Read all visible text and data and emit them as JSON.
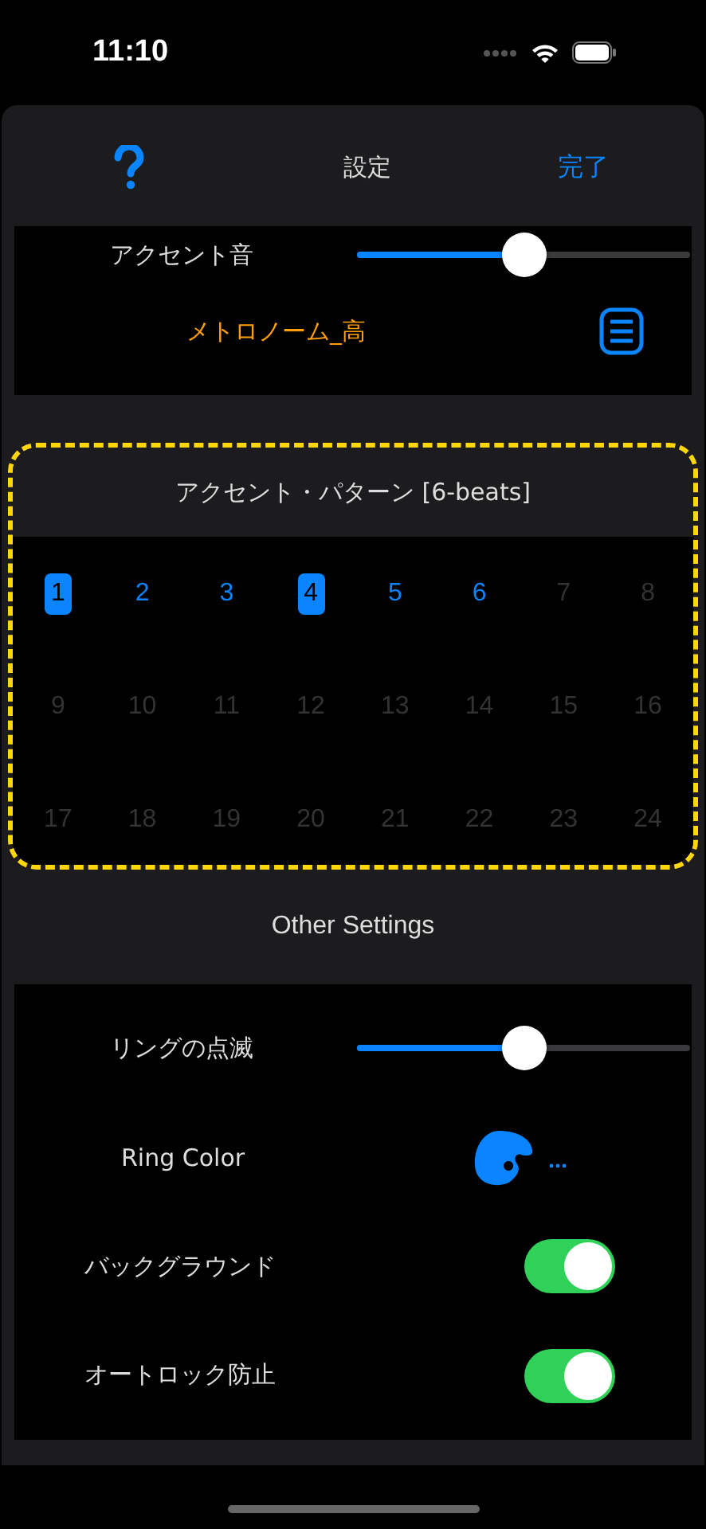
{
  "status_bar": {
    "time": "11:10"
  },
  "header": {
    "title": "設定",
    "done": "完了"
  },
  "accent_sound": {
    "label": "アクセント音",
    "level": 0.5,
    "sound_name": "メトロノーム_高"
  },
  "accent_pattern": {
    "title": "アクセント・パターン  [6-beats]",
    "beats": [
      {
        "label": "1",
        "selected": true,
        "enabled": true
      },
      {
        "label": "2",
        "selected": false,
        "enabled": true
      },
      {
        "label": "3",
        "selected": false,
        "enabled": true
      },
      {
        "label": "4",
        "selected": true,
        "enabled": true
      },
      {
        "label": "5",
        "selected": false,
        "enabled": true
      },
      {
        "label": "6",
        "selected": false,
        "enabled": true
      },
      {
        "label": "7",
        "selected": false,
        "enabled": false
      },
      {
        "label": "8",
        "selected": false,
        "enabled": false
      },
      {
        "label": "9",
        "selected": false,
        "enabled": false
      },
      {
        "label": "10",
        "selected": false,
        "enabled": false
      },
      {
        "label": "11",
        "selected": false,
        "enabled": false
      },
      {
        "label": "12",
        "selected": false,
        "enabled": false
      },
      {
        "label": "13",
        "selected": false,
        "enabled": false
      },
      {
        "label": "14",
        "selected": false,
        "enabled": false
      },
      {
        "label": "15",
        "selected": false,
        "enabled": false
      },
      {
        "label": "16",
        "selected": false,
        "enabled": false
      },
      {
        "label": "17",
        "selected": false,
        "enabled": false
      },
      {
        "label": "18",
        "selected": false,
        "enabled": false
      },
      {
        "label": "19",
        "selected": false,
        "enabled": false
      },
      {
        "label": "20",
        "selected": false,
        "enabled": false
      },
      {
        "label": "21",
        "selected": false,
        "enabled": false
      },
      {
        "label": "22",
        "selected": false,
        "enabled": false
      },
      {
        "label": "23",
        "selected": false,
        "enabled": false
      },
      {
        "label": "24",
        "selected": false,
        "enabled": false
      }
    ]
  },
  "other_settings": {
    "title": "Other Settings",
    "rows": [
      {
        "kind": "slider",
        "label": "リングの点滅",
        "level": 0.5
      },
      {
        "kind": "color",
        "label": "Ring Color"
      },
      {
        "kind": "toggle",
        "label": "バックグラウンド",
        "on": true
      },
      {
        "kind": "toggle",
        "label": "オートロック防止",
        "on": true
      }
    ]
  }
}
